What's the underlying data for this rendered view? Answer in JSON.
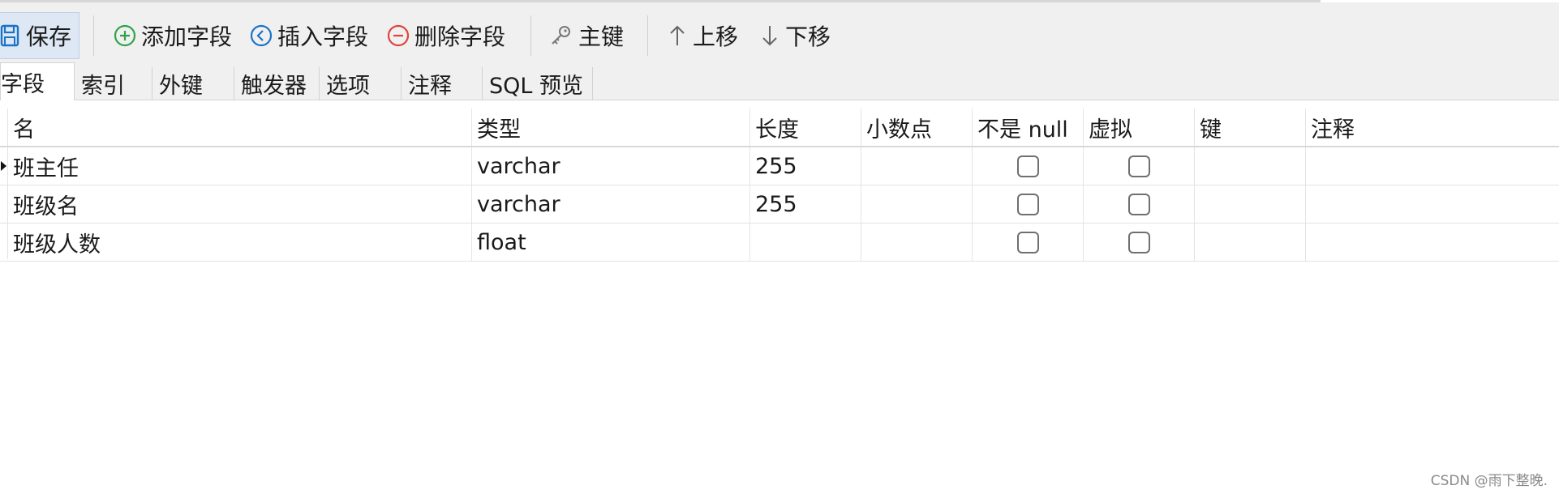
{
  "toolbar": {
    "save": "保存",
    "add_field": "添加字段",
    "insert_field": "插入字段",
    "delete_field": "删除字段",
    "primary_key": "主键",
    "move_up": "上移",
    "move_down": "下移",
    "icons": [
      "save-icon",
      "add-icon",
      "insert-icon",
      "delete-icon",
      "key-icon",
      "arrow-up-icon",
      "arrow-down-icon"
    ]
  },
  "tabs": [
    "字段",
    "索引",
    "外键",
    "触发器",
    "选项",
    "注释",
    "SQL 预览"
  ],
  "table": {
    "columns": [
      "名",
      "类型",
      "长度",
      "小数点",
      "不是 null",
      "虚拟",
      "键",
      "注释"
    ],
    "rows": [
      {
        "name": "班主任",
        "type": "varchar",
        "length": "255",
        "decimal": "",
        "not_null": false,
        "virtual": false,
        "key": "",
        "comment": ""
      },
      {
        "name": "班级名",
        "type": "varchar",
        "length": "255",
        "decimal": "",
        "not_null": false,
        "virtual": false,
        "key": "",
        "comment": ""
      },
      {
        "name": "班级人数",
        "type": "float",
        "length": "",
        "decimal": "",
        "not_null": false,
        "virtual": false,
        "key": "",
        "comment": ""
      }
    ]
  },
  "watermark": "CSDN @雨下整晚.",
  "colors": {
    "accent": "#1a73c9",
    "add": "#2fa34a",
    "delete": "#e0433c",
    "toolbar_bg": "#f0f0f0"
  }
}
